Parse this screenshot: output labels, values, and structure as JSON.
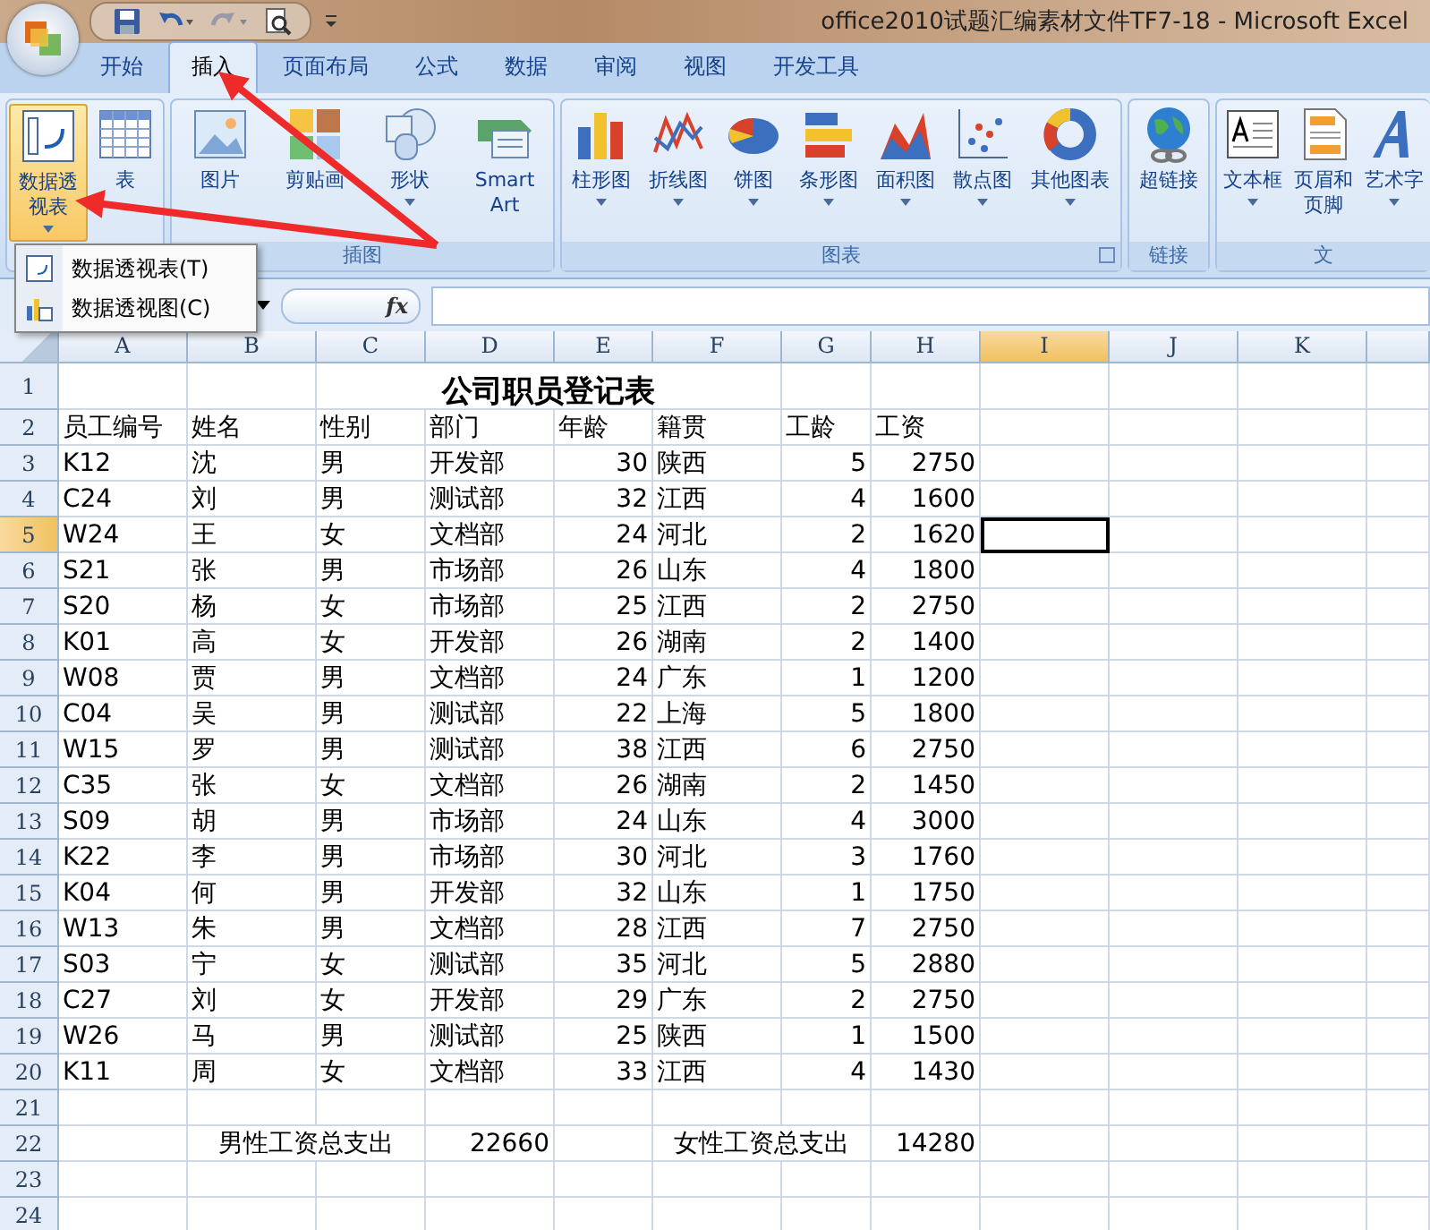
{
  "window": {
    "title": "office2010试题汇编素材文件TF7-18 - Microsoft Excel"
  },
  "tabs": [
    {
      "label": "开始",
      "selected": false
    },
    {
      "label": "插入",
      "selected": true
    },
    {
      "label": "页面布局",
      "selected": false
    },
    {
      "label": "公式",
      "selected": false
    },
    {
      "label": "数据",
      "selected": false
    },
    {
      "label": "审阅",
      "selected": false
    },
    {
      "label": "视图",
      "selected": false
    },
    {
      "label": "开发工具",
      "selected": false
    }
  ],
  "ribbon_groups": [
    {
      "buttons": [
        {
          "label": "数据透视表",
          "dropdown": true,
          "pressed": true
        },
        {
          "label": "表",
          "dropdown": false,
          "pressed": false
        }
      ]
    },
    {
      "label": "插图",
      "buttons": [
        {
          "label": "图片",
          "dropdown": false,
          "pressed": false
        },
        {
          "label": "剪贴画",
          "dropdown": false,
          "pressed": false
        },
        {
          "label": "形状",
          "dropdown": true,
          "pressed": false
        },
        {
          "label": "SmartArt",
          "dropdown": false,
          "pressed": false
        }
      ]
    },
    {
      "label": "图表",
      "launcher": true,
      "buttons": [
        {
          "label": "柱形图",
          "dropdown": true,
          "pressed": false
        },
        {
          "label": "折线图",
          "dropdown": true,
          "pressed": false
        },
        {
          "label": "饼图",
          "dropdown": true,
          "pressed": false
        },
        {
          "label": "条形图",
          "dropdown": true,
          "pressed": false
        },
        {
          "label": "面积图",
          "dropdown": true,
          "pressed": false
        },
        {
          "label": "散点图",
          "dropdown": true,
          "pressed": false
        },
        {
          "label": "其他图表",
          "dropdown": true,
          "pressed": false
        }
      ]
    },
    {
      "label": "链接",
      "buttons": [
        {
          "label": "超链接",
          "dropdown": false,
          "pressed": false
        }
      ]
    },
    {
      "label": "文",
      "buttons": [
        {
          "label": "文本框",
          "dropdown": true,
          "pressed": false
        },
        {
          "label": "页眉和页脚",
          "dropdown": false,
          "pressed": false
        },
        {
          "label": "艺术字",
          "dropdown": true,
          "pressed": false
        }
      ]
    }
  ],
  "dropdown_menu": [
    {
      "label": "数据透视表(T)"
    },
    {
      "label": "数据透视图(C)"
    }
  ],
  "formula_bar": {
    "function_label": "fx"
  },
  "columns": [
    {
      "label": "A",
      "selected": false
    },
    {
      "label": "B",
      "selected": false
    },
    {
      "label": "C",
      "selected": false
    },
    {
      "label": "D",
      "selected": false
    },
    {
      "label": "E",
      "selected": false
    },
    {
      "label": "F",
      "selected": false
    },
    {
      "label": "G",
      "selected": false
    },
    {
      "label": "H",
      "selected": false
    },
    {
      "label": "I",
      "selected": true
    },
    {
      "label": "J",
      "selected": false
    },
    {
      "label": "K",
      "selected": false
    }
  ],
  "row_numbers": [
    {
      "label": "1",
      "selected": false
    },
    {
      "label": "2",
      "selected": false
    },
    {
      "label": "3",
      "selected": false
    },
    {
      "label": "4",
      "selected": false
    },
    {
      "label": "5",
      "selected": true
    },
    {
      "label": "6",
      "selected": false
    },
    {
      "label": "7",
      "selected": false
    },
    {
      "label": "8",
      "selected": false
    },
    {
      "label": "9",
      "selected": false
    },
    {
      "label": "10",
      "selected": false
    },
    {
      "label": "11",
      "selected": false
    },
    {
      "label": "12",
      "selected": false
    },
    {
      "label": "13",
      "selected": false
    },
    {
      "label": "14",
      "selected": false
    },
    {
      "label": "15",
      "selected": false
    },
    {
      "label": "16",
      "selected": false
    },
    {
      "label": "17",
      "selected": false
    },
    {
      "label": "18",
      "selected": false
    },
    {
      "label": "19",
      "selected": false
    },
    {
      "label": "20",
      "selected": false
    },
    {
      "label": "21",
      "selected": false
    },
    {
      "label": "22",
      "selected": false
    },
    {
      "label": "23",
      "selected": false
    },
    {
      "label": "24",
      "selected": false
    }
  ],
  "sheet_title": "公司职员登记表",
  "headers": [
    "员工编号",
    "姓名",
    "性别",
    "部门",
    "年龄",
    "籍贯",
    "工龄",
    "工资"
  ],
  "records": [
    [
      "K12",
      "沈",
      "男",
      "开发部",
      "30",
      "陕西",
      "5",
      "2750"
    ],
    [
      "C24",
      "刘",
      "男",
      "测试部",
      "32",
      "江西",
      "4",
      "1600"
    ],
    [
      "W24",
      "王",
      "女",
      "文档部",
      "24",
      "河北",
      "2",
      "1620"
    ],
    [
      "S21",
      "张",
      "男",
      "市场部",
      "26",
      "山东",
      "4",
      "1800"
    ],
    [
      "S20",
      "杨",
      "女",
      "市场部",
      "25",
      "江西",
      "2",
      "2750"
    ],
    [
      "K01",
      "高",
      "女",
      "开发部",
      "26",
      "湖南",
      "2",
      "1400"
    ],
    [
      "W08",
      "贾",
      "男",
      "文档部",
      "24",
      "广东",
      "1",
      "1200"
    ],
    [
      "C04",
      "吴",
      "男",
      "测试部",
      "22",
      "上海",
      "5",
      "1800"
    ],
    [
      "W15",
      "罗",
      "男",
      "测试部",
      "38",
      "江西",
      "6",
      "2750"
    ],
    [
      "C35",
      "张",
      "女",
      "文档部",
      "26",
      "湖南",
      "2",
      "1450"
    ],
    [
      "S09",
      "胡",
      "男",
      "市场部",
      "24",
      "山东",
      "4",
      "3000"
    ],
    [
      "K22",
      "李",
      "男",
      "市场部",
      "30",
      "河北",
      "3",
      "1760"
    ],
    [
      "K04",
      "何",
      "男",
      "开发部",
      "32",
      "山东",
      "1",
      "1750"
    ],
    [
      "W13",
      "朱",
      "男",
      "文档部",
      "28",
      "江西",
      "7",
      "2750"
    ],
    [
      "S03",
      "宁",
      "女",
      "测试部",
      "35",
      "河北",
      "5",
      "2880"
    ],
    [
      "C27",
      "刘",
      "女",
      "开发部",
      "29",
      "广东",
      "2",
      "2750"
    ],
    [
      "W26",
      "马",
      "男",
      "测试部",
      "25",
      "陕西",
      "1",
      "1500"
    ],
    [
      "K11",
      "周",
      "女",
      "文档部",
      "33",
      "江西",
      "4",
      "1430"
    ]
  ],
  "summary": [
    {
      "label": "男性工资总支出",
      "value": "22660"
    },
    {
      "label": "女性工资总支出",
      "value": "14280"
    }
  ]
}
